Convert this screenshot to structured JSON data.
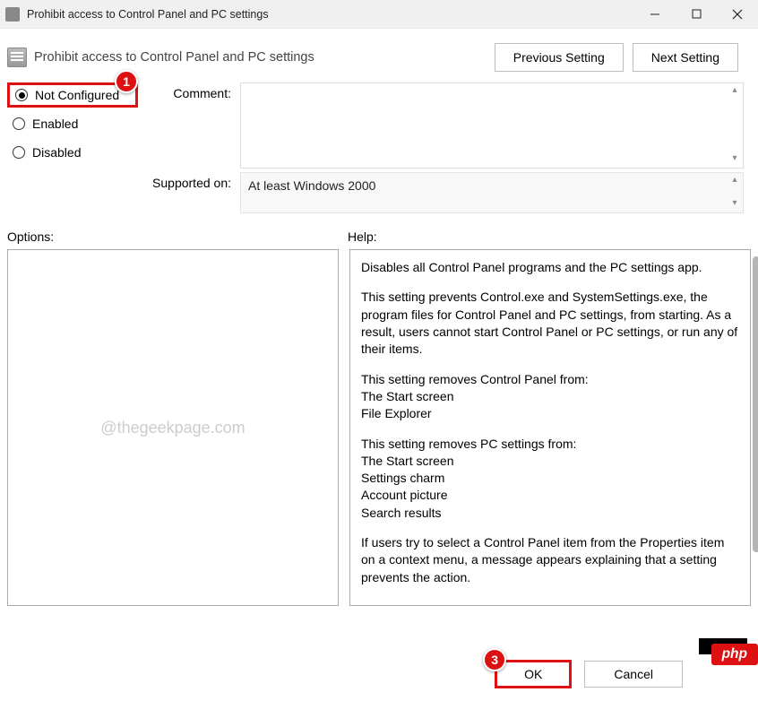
{
  "window": {
    "title": "Prohibit access to Control Panel and PC settings"
  },
  "header": {
    "policy_name": "Prohibit access to Control Panel and PC settings",
    "prev_label": "Previous Setting",
    "next_label": "Next Setting"
  },
  "state": {
    "not_configured": "Not Configured",
    "enabled": "Enabled",
    "disabled": "Disabled",
    "selected": "not_configured"
  },
  "labels": {
    "comment": "Comment:",
    "supported_on": "Supported on:",
    "options": "Options:",
    "help": "Help:"
  },
  "supported_text": "At least Windows 2000",
  "options_watermark": "@thegeekpage.com",
  "help_text": {
    "p1": "Disables all Control Panel programs and the PC settings app.",
    "p2": "This setting prevents Control.exe and SystemSettings.exe, the program files for Control Panel and PC settings, from starting. As a result, users cannot start Control Panel or PC settings, or run any of their items.",
    "p3": "This setting removes Control Panel from:",
    "p3a": "The Start screen",
    "p3b": "File Explorer",
    "p4": "This setting removes PC settings from:",
    "p4a": "The Start screen",
    "p4b": "Settings charm",
    "p4c": "Account picture",
    "p4d": "Search results",
    "p5": "If users try to select a Control Panel item from the Properties item on a context menu, a message appears explaining that a setting prevents the action."
  },
  "footer": {
    "ok": "OK",
    "cancel": "Cancel"
  },
  "callouts": {
    "c1": "1",
    "c3": "3"
  },
  "badge": "php"
}
